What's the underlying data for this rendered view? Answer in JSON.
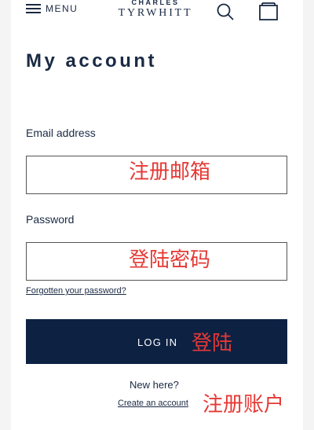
{
  "header": {
    "menu_label": "MENU",
    "brand_top": "CHARLES",
    "brand_bottom": "TYRWHITT",
    "icons": [
      "menu-icon",
      "search-icon",
      "shopping-bag-icon"
    ]
  },
  "page_title": "My account",
  "form": {
    "email_label": "Email address",
    "email_value": "",
    "password_label": "Password",
    "password_value": "",
    "forgot_link": "Forgotten your password?",
    "login_button": "LOG IN",
    "new_here": "New here?",
    "create_link": "Create an account"
  },
  "annotations": {
    "email": "注册邮箱",
    "password": "登陆密码",
    "login": "登陆",
    "create": "注册账户"
  },
  "colors": {
    "navy": "#0d2143",
    "text": "#1a2a44",
    "annotation_red": "#e53935",
    "border": "#555555"
  }
}
